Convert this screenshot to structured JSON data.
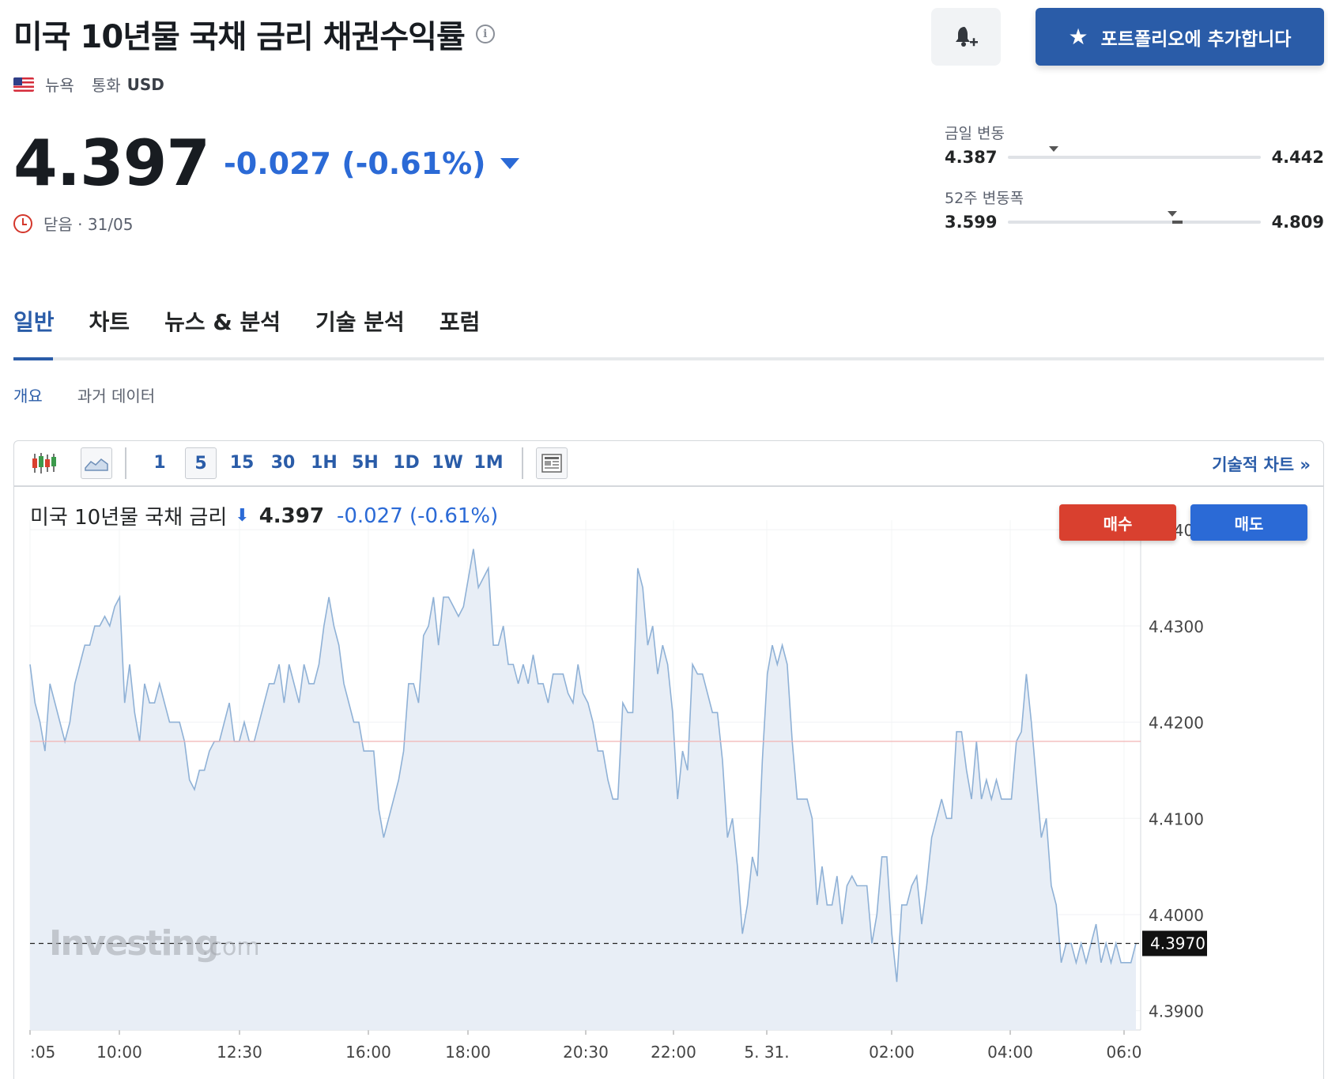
{
  "header": {
    "title": "미국 10년물 국채 금리 채권수익률",
    "location": "뉴욕",
    "currency_label": "통화",
    "currency": "USD",
    "add_portfolio_label": "포트폴리오에 추가합니다"
  },
  "quote": {
    "price": "4.397",
    "change": "-0.027 (-0.61%)",
    "status": "닫음 · 31/05"
  },
  "ranges": {
    "day": {
      "label": "금일 변동",
      "low": "4.387",
      "high": "4.442",
      "current_fraction": 0.18
    },
    "week52": {
      "label": "52주 변동폭",
      "low": "3.599",
      "high": "4.809",
      "current_fraction": 0.65
    }
  },
  "tabs": [
    "일반",
    "차트",
    "뉴스 & 분석",
    "기술 분석",
    "포럼"
  ],
  "subtabs": [
    "개요",
    "과거 데이터"
  ],
  "toolbar": {
    "intervals": [
      "1",
      "5",
      "15",
      "30",
      "1H",
      "5H",
      "1D",
      "1W",
      "1M"
    ],
    "active_interval": "5",
    "tech_chart_label": "기술적 차트 »"
  },
  "chart_header": {
    "name": "미국 10년물 국채 금리",
    "price": "4.397",
    "change": "-0.027 (-0.61%)",
    "buy_label": "매수",
    "sell_label": "매도"
  },
  "colors": {
    "accent": "#2a5ca8",
    "down": "#2b6ad6",
    "buy": "#d9402f",
    "line": "#8fb1d6",
    "fill": "#e8eef6"
  },
  "chart_data": {
    "type": "area",
    "x_tick_labels": [
      ":05",
      "10:00",
      "12:30",
      "16:00",
      "18:00",
      "20:30",
      "22:00",
      "5. 31.",
      "02:00",
      "04:00",
      "06:0"
    ],
    "y_ticks": [
      "4.4400",
      "4.4300",
      "4.4200",
      "4.4100",
      "4.4000",
      "4.3900"
    ],
    "ylim": [
      4.388,
      4.441
    ],
    "reference_line": 4.418,
    "last_value_label": "4.3970",
    "last_value": 4.397,
    "watermark": "Investing",
    "watermark_suffix": ".com",
    "values": [
      4.426,
      4.422,
      4.42,
      4.417,
      4.424,
      4.422,
      4.42,
      4.418,
      4.42,
      4.424,
      4.426,
      4.428,
      4.428,
      4.43,
      4.43,
      4.431,
      4.43,
      4.432,
      4.433,
      4.422,
      4.426,
      4.421,
      4.418,
      4.424,
      4.422,
      4.422,
      4.424,
      4.422,
      4.42,
      4.42,
      4.42,
      4.418,
      4.414,
      4.413,
      4.415,
      4.415,
      4.417,
      4.418,
      4.418,
      4.42,
      4.422,
      4.418,
      4.418,
      4.42,
      4.418,
      4.418,
      4.42,
      4.422,
      4.424,
      4.424,
      4.426,
      4.422,
      4.426,
      4.424,
      4.422,
      4.426,
      4.424,
      4.424,
      4.426,
      4.43,
      4.433,
      4.43,
      4.428,
      4.424,
      4.422,
      4.42,
      4.42,
      4.417,
      4.417,
      4.417,
      4.411,
      4.408,
      4.41,
      4.412,
      4.414,
      4.417,
      4.424,
      4.424,
      4.422,
      4.429,
      4.43,
      4.433,
      4.428,
      4.433,
      4.433,
      4.432,
      4.431,
      4.432,
      4.435,
      4.438,
      4.434,
      4.435,
      4.436,
      4.428,
      4.428,
      4.43,
      4.426,
      4.426,
      4.424,
      4.426,
      4.424,
      4.427,
      4.424,
      4.424,
      4.422,
      4.425,
      4.425,
      4.425,
      4.423,
      4.422,
      4.426,
      4.423,
      4.422,
      4.42,
      4.417,
      4.417,
      4.414,
      4.412,
      4.412,
      4.422,
      4.421,
      4.421,
      4.436,
      4.434,
      4.428,
      4.43,
      4.425,
      4.428,
      4.426,
      4.421,
      4.412,
      4.417,
      4.415,
      4.426,
      4.425,
      4.425,
      4.423,
      4.421,
      4.421,
      4.416,
      4.408,
      4.41,
      4.405,
      4.398,
      4.401,
      4.406,
      4.404,
      4.416,
      4.425,
      4.428,
      4.426,
      4.428,
      4.426,
      4.418,
      4.412,
      4.412,
      4.412,
      4.41,
      4.401,
      4.405,
      4.401,
      4.401,
      4.404,
      4.399,
      4.403,
      4.404,
      4.403,
      4.403,
      4.403,
      4.397,
      4.4,
      4.406,
      4.406,
      4.398,
      4.393,
      4.401,
      4.401,
      4.403,
      4.404,
      4.399,
      4.403,
      4.408,
      4.41,
      4.412,
      4.41,
      4.41,
      4.419,
      4.419,
      4.415,
      4.412,
      4.418,
      4.412,
      4.414,
      4.412,
      4.414,
      4.412,
      4.412,
      4.412,
      4.418,
      4.419,
      4.425,
      4.42,
      4.414,
      4.408,
      4.41,
      4.403,
      4.401,
      4.395,
      4.397,
      4.397,
      4.395,
      4.397,
      4.395,
      4.397,
      4.399,
      4.395,
      4.397,
      4.395,
      4.397,
      4.395,
      4.395,
      4.395,
      4.397
    ]
  }
}
